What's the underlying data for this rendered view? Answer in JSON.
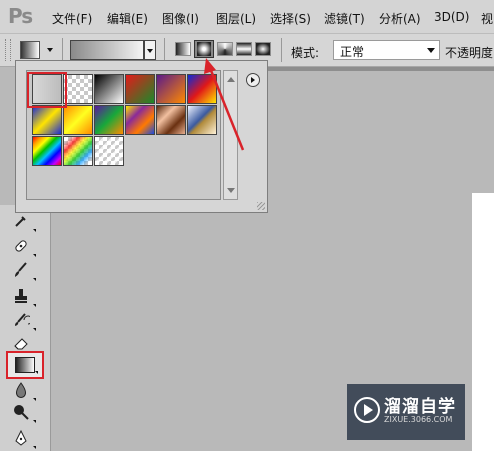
{
  "app": {
    "logo": "Ps"
  },
  "menu": [
    "文件(F)",
    "编辑(E)",
    "图像(I)",
    "图层(L)",
    "选择(S)",
    "滤镜(T)",
    "分析(A)",
    "3D(D)",
    "视"
  ],
  "options": {
    "mode_label": "模式:",
    "mode_value": "正常",
    "opacity_label": "不透明度:",
    "gradient_types": [
      "linear",
      "radial",
      "angle",
      "reflected",
      "diamond"
    ],
    "selected_gradient_type": "radial"
  },
  "gradient_presets": [
    "Foreground to Background",
    "Foreground to Transparent",
    "Black, White",
    "Red, Green",
    "Violet, Orange",
    "Blue, Red, Yellow",
    "Blue, Yellow, Blue",
    "Orange, Yellow, Orange",
    "Violet, Green, Orange",
    "Yellow, Violet, Orange, Blue",
    "Copper",
    "Chrome",
    "Spectrum",
    "Transparent Rainbow",
    "Transparent Stripes"
  ],
  "selected_preset_index": 0,
  "watermark": {
    "brand": "溜溜自学",
    "url": "ZIXUE.3066.COM"
  },
  "annotation_color": "#d9232a"
}
